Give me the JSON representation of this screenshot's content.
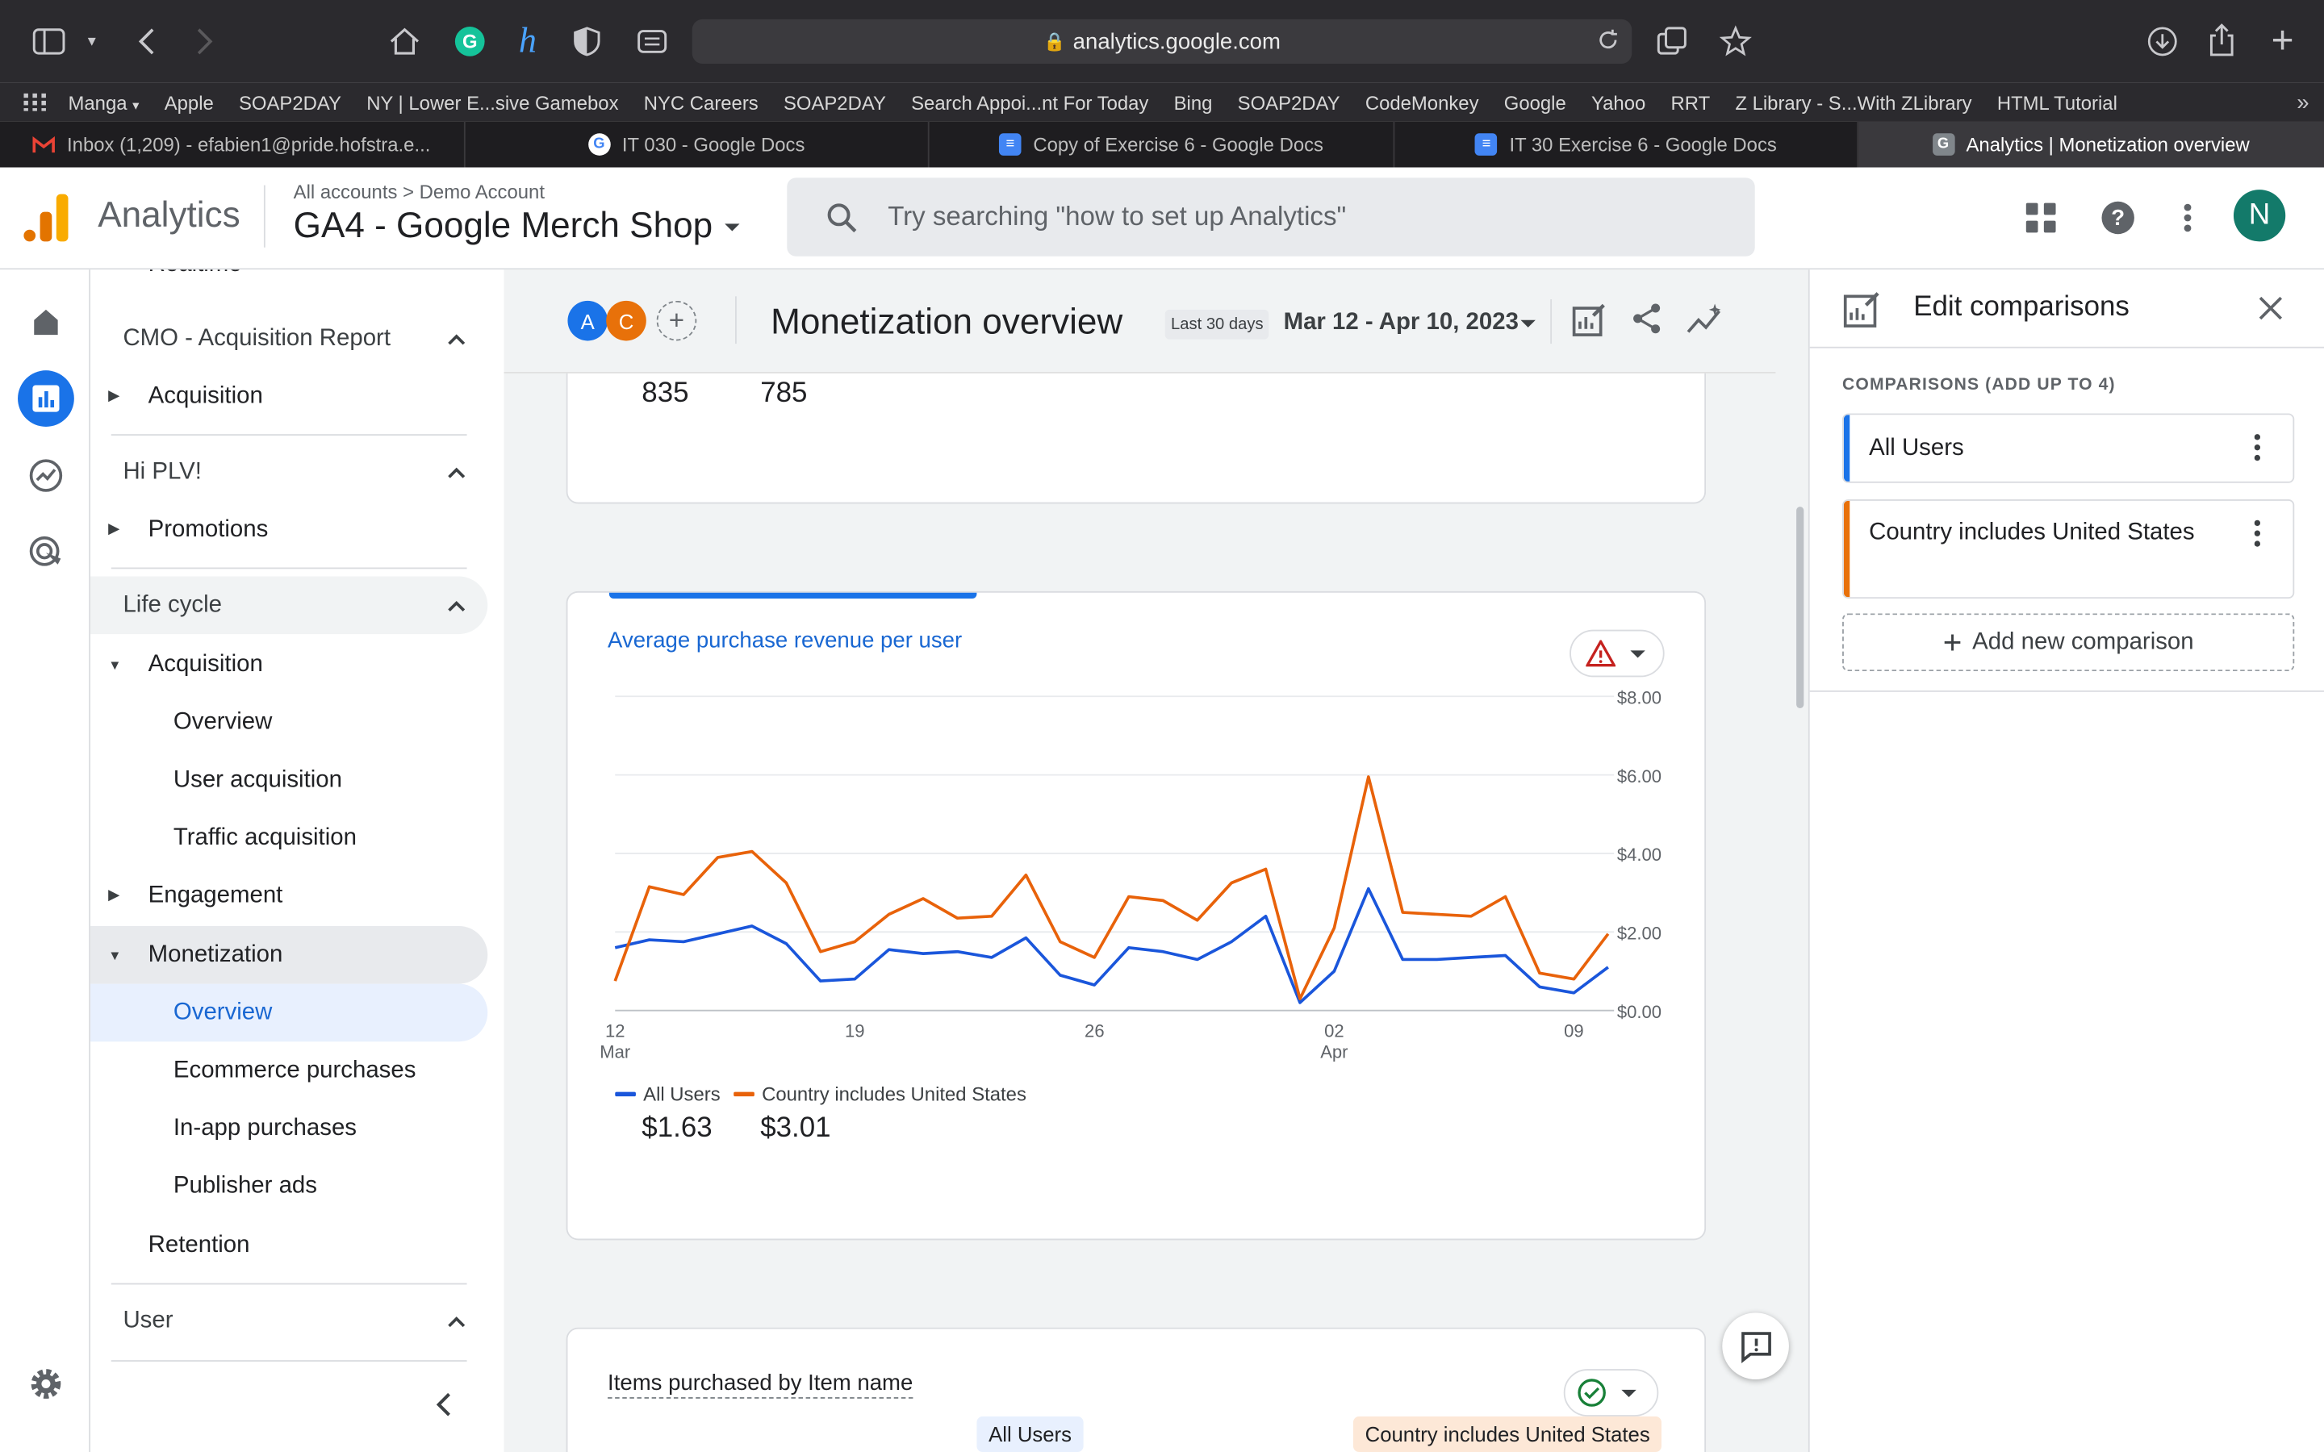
{
  "browser": {
    "url": "analytics.google.com",
    "bookmarks": [
      "Manga",
      "Apple",
      "SOAP2DAY",
      "NY | Lower E...sive Gamebox",
      "NYC Careers",
      "SOAP2DAY",
      "Search Appoi...nt For Today",
      "Bing",
      "SOAP2DAY",
      "CodeMonkey",
      "Google",
      "Yahoo",
      "RRT",
      "Z Library - S...With ZLibrary",
      "HTML Tutorial"
    ],
    "tabs": [
      {
        "label": "Inbox (1,209) - efabien1@pride.hofstra.e...",
        "icon": "gmail-icon",
        "color": "#ea4335"
      },
      {
        "label": "IT 030 - Google Docs",
        "icon": "google-icon",
        "color": "#4285f4"
      },
      {
        "label": "Copy of Exercise 6 - Google Docs",
        "icon": "docs-icon",
        "color": "#4285f4"
      },
      {
        "label": "IT 30 Exercise 6 - Google Docs",
        "icon": "docs-icon",
        "color": "#4285f4"
      },
      {
        "label": "Analytics | Monetization overview",
        "icon": "analytics-icon",
        "color": "#80868b"
      }
    ]
  },
  "header": {
    "app_name": "Analytics",
    "breadcrumb_root": "All accounts",
    "breadcrumb_sep": ">",
    "breadcrumb_account": "Demo Account",
    "property": "GA4 - Google Merch Shop",
    "search_placeholder": "Try searching \"how to set up Analytics\"",
    "avatar_initial": "N"
  },
  "menu": {
    "cut_top": "Realtime",
    "sections": [
      {
        "label": "CMO - Acquisition Report"
      },
      {
        "label": "Hi PLV!"
      },
      {
        "label": "Life cycle"
      },
      {
        "label": "User"
      }
    ],
    "items": {
      "cmo_acquisition": "Acquisition",
      "promotions": "Promotions",
      "acquisition": "Acquisition",
      "overview": "Overview",
      "user_acquisition": "User acquisition",
      "traffic_acquisition": "Traffic acquisition",
      "engagement": "Engagement",
      "monetization": "Monetization",
      "monetization_overview": "Overview",
      "ecommerce_purchases": "Ecommerce purchases",
      "in_app_purchases": "In-app purchases",
      "publisher_ads": "Publisher ads",
      "retention": "Retention"
    }
  },
  "report": {
    "chip_a": "A",
    "chip_c": "C",
    "chip_a_color": "#1a73e8",
    "chip_c_color": "#e8710a",
    "title": "Monetization overview",
    "range_label": "Last 30 days",
    "range_dates": "Mar 12 - Apr 10, 2023",
    "top_card": {
      "value_all": "835",
      "value_us": "785"
    },
    "chart_card": {
      "title": "Average purchase revenue per user",
      "legend_all": "All Users",
      "legend_us": "Country includes United States",
      "total_all": "$1.63",
      "total_us": "$3.01"
    },
    "items_card": {
      "title": "Items purchased by Item name",
      "tag_all": "All Users",
      "tag_us": "Country includes United States"
    }
  },
  "chart_data": {
    "type": "line",
    "title": "Average purchase revenue per user",
    "x": [
      "Mar 12",
      "Mar 13",
      "Mar 14",
      "Mar 15",
      "Mar 16",
      "Mar 17",
      "Mar 18",
      "Mar 19",
      "Mar 20",
      "Mar 21",
      "Mar 22",
      "Mar 23",
      "Mar 24",
      "Mar 25",
      "Mar 26",
      "Mar 27",
      "Mar 28",
      "Mar 29",
      "Mar 30",
      "Mar 31",
      "Apr 1",
      "Apr 2",
      "Apr 3",
      "Apr 4",
      "Apr 5",
      "Apr 6",
      "Apr 7",
      "Apr 8",
      "Apr 9",
      "Apr 10"
    ],
    "x_tick_labels": [
      {
        "label": "12",
        "sub": "Mar",
        "index": 0
      },
      {
        "label": "19",
        "sub": "",
        "index": 7
      },
      {
        "label": "26",
        "sub": "",
        "index": 14
      },
      {
        "label": "02",
        "sub": "Apr",
        "index": 21
      },
      {
        "label": "09",
        "sub": "",
        "index": 28
      }
    ],
    "y_ticks": [
      "$0.00",
      "$2.00",
      "$4.00",
      "$6.00",
      "$8.00"
    ],
    "ylim": [
      0,
      8
    ],
    "y_axis_side": "right",
    "grid": true,
    "legend_position": "bottom-left",
    "series": [
      {
        "name": "All Users",
        "color": "#1a56db",
        "values": [
          1.6,
          1.8,
          1.75,
          1.95,
          2.15,
          1.7,
          0.75,
          0.8,
          1.55,
          1.45,
          1.5,
          1.35,
          1.85,
          0.9,
          0.65,
          1.6,
          1.5,
          1.3,
          1.75,
          2.4,
          0.2,
          1.0,
          3.1,
          1.3,
          1.3,
          1.35,
          1.4,
          0.6,
          0.45,
          1.1
        ]
      },
      {
        "name": "Country includes United States",
        "color": "#e8620a",
        "values": [
          0.75,
          3.15,
          2.95,
          3.9,
          4.05,
          3.25,
          1.5,
          1.75,
          2.45,
          2.85,
          2.35,
          2.4,
          3.45,
          1.75,
          1.35,
          2.9,
          2.8,
          2.3,
          3.25,
          3.6,
          0.3,
          2.1,
          5.95,
          2.5,
          2.45,
          2.4,
          2.9,
          0.95,
          0.8,
          1.95
        ]
      }
    ]
  },
  "panel": {
    "title": "Edit comparisons",
    "subtitle": "COMPARISONS (ADD UP TO 4)",
    "comparisons": [
      {
        "label": "All Users",
        "color": "#1a73e8"
      },
      {
        "label": "Country includes United States",
        "color": "#e8710a"
      }
    ],
    "add_label": "Add new comparison"
  }
}
